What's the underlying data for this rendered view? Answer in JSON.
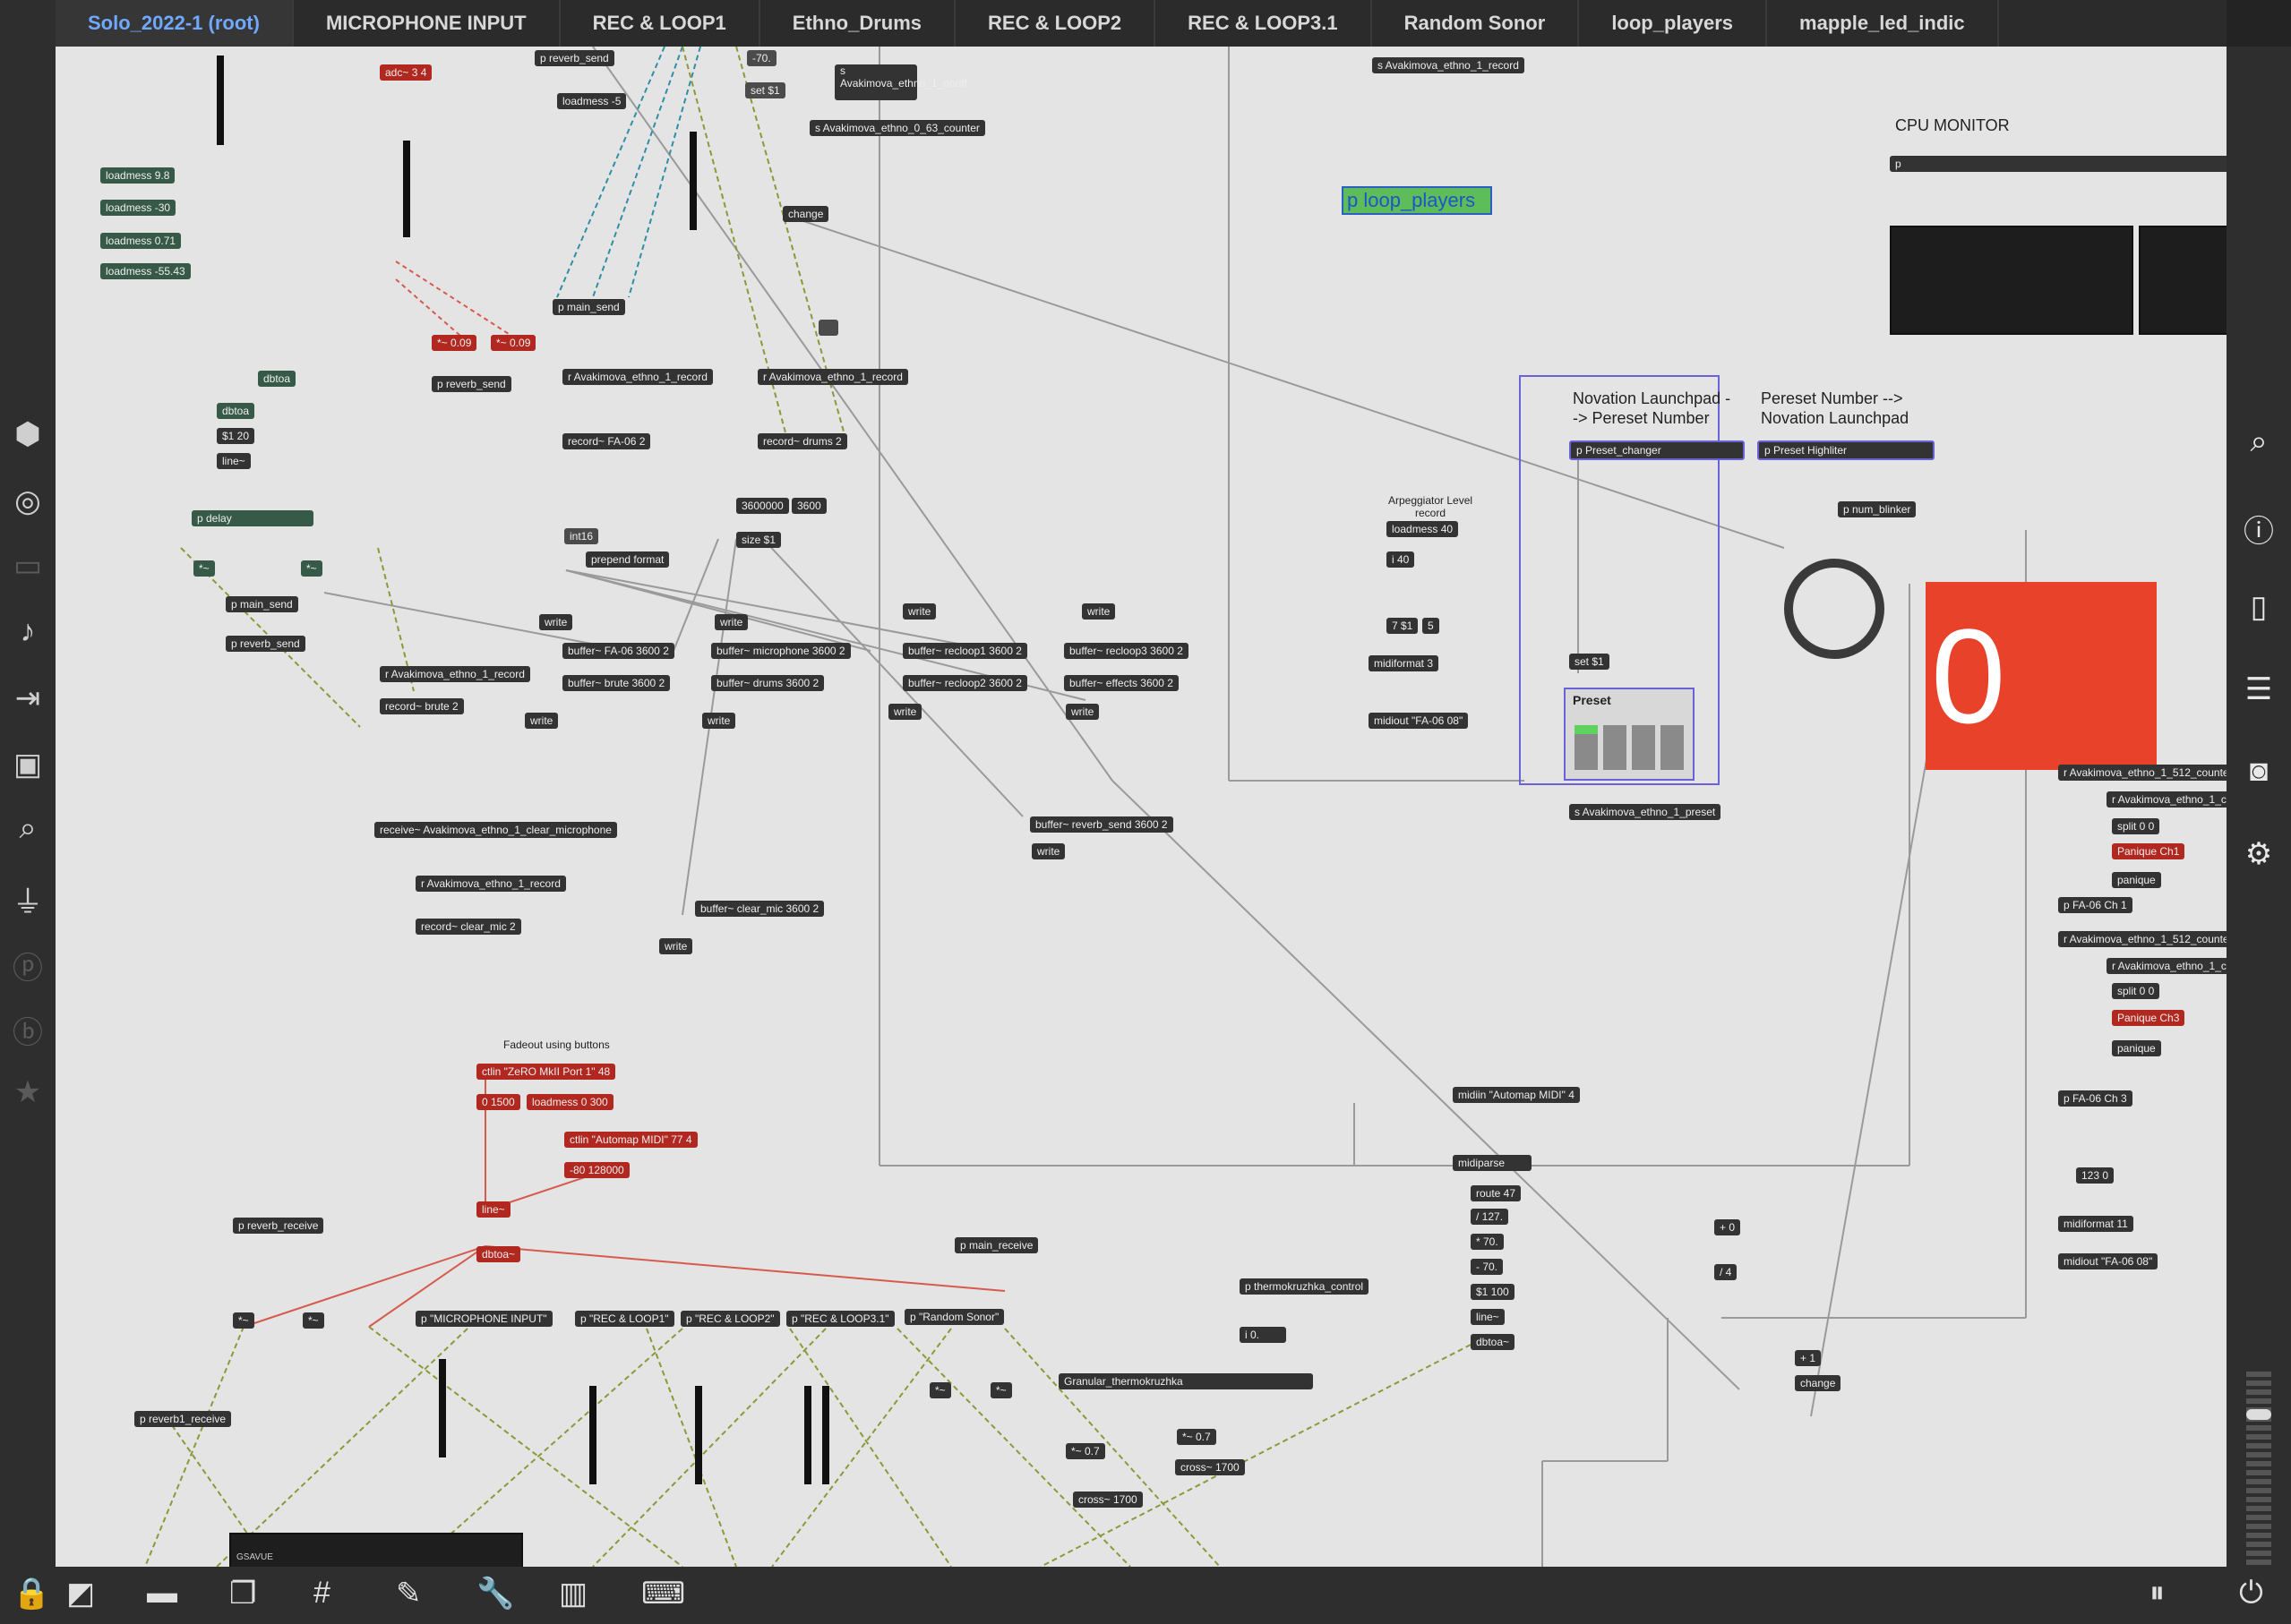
{
  "tabs": [
    {
      "label": "Solo_2022-1 (root)",
      "active": true
    },
    {
      "label": "MICROPHONE INPUT"
    },
    {
      "label": "REC & LOOP1"
    },
    {
      "label": "Ethno_Drums"
    },
    {
      "label": "REC & LOOP2"
    },
    {
      "label": "REC & LOOP3.1"
    },
    {
      "label": "Random Sonor"
    },
    {
      "label": "loop_players"
    },
    {
      "label": "mapple_led_indic"
    }
  ],
  "objects": {
    "adc": "adc~ 3 4",
    "p_reverb_send_top": "p reverb_send",
    "loadmess_minus5": "loadmess -5",
    "set1": "set $1",
    "minus70": "-70.",
    "s_onoff": "s Avakimova_ethno_1_onoff",
    "s_counter": "s Avakimova_ethno_0_63_counter",
    "s_record_top": "s Avakimova_ethno_1_record",
    "loadmess98": "loadmess 9.8",
    "loadmess_30": "loadmess -30",
    "loadmess071": "loadmess 0.71",
    "loadmess5543": "loadmess -55.43",
    "change_top": "change",
    "p_main_send_top": "p main_send",
    "times009a": "*~ 0.09",
    "times009b": "*~ 0.09",
    "p_reverb_send2": "p reverb_send",
    "r_record1": "r Avakimova_ethno_1_record",
    "record_fa06": "record~ FA-06 2",
    "r_record2": "r Avakimova_ethno_1_record",
    "record_drums": "record~ drums 2",
    "p_loop_players": "p loop_players",
    "cpu_monitor": "CPU MONITOR",
    "p_cpu": "p",
    "dbtoa": "dbtoa",
    "dbtoa2": "dbtoa",
    "s120": "$1 20",
    "line": "line~",
    "p_delay": "p delay",
    "tilde1": "*~",
    "tilde2": "*~",
    "p_main_send": "p main_send",
    "p_reverb_send3": "p reverb_send",
    "int16": "int16",
    "prepend_format": "prepend format",
    "n3600000": "3600000",
    "n3600": "3600",
    "size1": "size $1",
    "write1": "write",
    "write2": "write",
    "write3": "write",
    "write4": "write",
    "write5": "write",
    "write6": "write",
    "write7": "write",
    "write8": "write",
    "write9": "write",
    "write10": "write",
    "buf_fa06": "buffer~ FA-06 3600 2",
    "buf_brute": "buffer~ brute 3600 2",
    "buf_mic": "buffer~ microphone 3600 2",
    "buf_drums": "buffer~ drums 3600 2",
    "buf_recloop1": "buffer~ recloop1 3600 2",
    "buf_recloop2": "buffer~ recloop2 3600 2",
    "buf_recloop3": "buffer~ recloop3 3600 2",
    "buf_effects": "buffer~ effects 3600 2",
    "buf_reverb": "buffer~ reverb_send 3600 2",
    "buf_clear": "buffer~ clear_mic 3600 2",
    "r_record3": "r Avakimova_ethno_1_record",
    "record_brute": "record~ brute 2",
    "receive_clear": "receive~ Avakimova_ethno_1_clear_microphone",
    "r_record4": "r Avakimova_ethno_1_record",
    "record_clear": "record~ clear_mic 2",
    "arp_label": "Arpeggiator Level record",
    "loadmess40": "loadmess 40",
    "i40": "i 40",
    "s7": "7 $1",
    "n5": "5",
    "midiformat3": "midiformat 3",
    "midiout_fa06": "midiout \"FA-06 08\"",
    "novation_label": "Novation Launchpad --> Pereset Number",
    "preset_label": "Pereset Number --> Novation Launchpad",
    "p_preset_changer": "p Preset_changer",
    "p_preset_highliter": "p Preset Highliter",
    "set1b": "set $1",
    "preset": "Preset",
    "s_preset": "s Avakimova_ethno_1_preset",
    "p_num_blinker": "p num_blinker",
    "big_number": "0",
    "r_counter1": "r Avakimova_ethno_1_512_counter",
    "r_ethno1": "r Avakimova_ethno_1_c",
    "split00": "split 0 0",
    "panique_ch1": "Panique Ch1",
    "panique1": "panique",
    "p_fa06_ch1": "p FA-06 Ch 1",
    "r_counter2": "r Avakimova_ethno_1_512_counter",
    "r_ethno2": "r Avakimova_ethno_1_c",
    "split00b": "split 0 0",
    "panique_ch3": "Panique Ch3",
    "panique2": "panique",
    "p_fa06_ch3": "p FA-06 Ch 3",
    "fadeout_label": "Fadeout using buttons",
    "ctlin_zero": "ctlin \"ZeRO MkII Port 1\" 48",
    "msg0_1500": "0 1500",
    "loadmess0_300": "loadmess 0 300",
    "ctlin_automap": "ctlin \"Automap MIDI\" 77 4",
    "msg80_128000": "-80 128000",
    "line2": "line~",
    "dbtoa3": "dbtoa~",
    "midiin_automap": "midiin \"Automap MIDI\" 4",
    "midiparse": "midiparse",
    "route47": "route 47",
    "div127": "/ 127.",
    "times70": "* 70.",
    "minus70b": "- 70.",
    "s1_100": "$1 100",
    "line3": "line~",
    "dbtoa4": "dbtoa~",
    "plus0": "+ 0",
    "div4": "/ 4",
    "plus1": "+ 1",
    "change2": "change",
    "n123": "123 0",
    "midiformat11": "midiformat 11",
    "midiout_fa06b": "midiout \"FA-06 08\"",
    "p_reverb_receive": "p reverb_receive",
    "p_main_receive": "p main_receive",
    "tilde3": "*~",
    "tilde4": "*~",
    "p_mic_input": "p \"MICROPHONE INPUT\"",
    "p_recloop1": "p \"REC & LOOP1\"",
    "p_recloop2": "p \"REC & LOOP2\"",
    "p_recloop31": "p \"REC & LOOP3.1\"",
    "p_random": "p \"Random Sonor\"",
    "tilde5": "*~",
    "tilde6": "*~",
    "p_thermo": "p thermokruzhka_control",
    "i0": "i 0.",
    "granular": "Granular_thermokruzhka",
    "times07": "*~ 0.7",
    "times07b": "*~ 0.7",
    "cross1700": "cross~ 1700",
    "cross1700b": "cross~ 1700",
    "p_reverb1_receive": "p reverb1_receive",
    "ezdac_label": "GSAVUE"
  },
  "icons": {
    "left": [
      "cube-icon",
      "target-icon",
      "media-icon",
      "music-note-icon",
      "play-list-icon",
      "image-icon",
      "clip-icon",
      "plug-icon",
      "circle-p-icon",
      "circle-b-icon",
      "star-icon"
    ],
    "right": [
      "search-icon",
      "info-icon",
      "book-icon",
      "list-icon",
      "camera-icon",
      "sliders-icon"
    ],
    "bottom": [
      "lock-icon",
      "edit-icon",
      "comment-icon",
      "windows-icon",
      "grid-icon",
      "pin-icon",
      "wrench-icon",
      "piano-icon",
      "keyboard-icon",
      "pause-icon",
      "power-icon"
    ]
  },
  "colors": {
    "accent": "#6fa8ff",
    "big_number_bg": "#e8432a",
    "loop_players_bg": "#5dbd5b"
  }
}
